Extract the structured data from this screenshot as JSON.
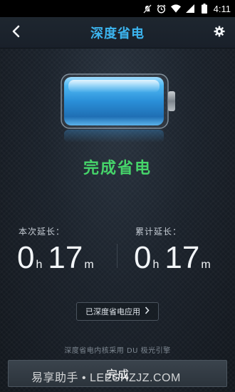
{
  "status_bar": {
    "time": "4:11",
    "icons": [
      "mute-icon",
      "alarm-icon",
      "wifi-icon",
      "signal-icon",
      "battery-icon"
    ]
  },
  "header": {
    "title": "深度省电",
    "back_icon": "chevron-left-icon",
    "settings_icon": "gear-icon"
  },
  "battery": {
    "level": 1.0,
    "color": "#3aa6e6"
  },
  "result": {
    "title": "完成省电",
    "color": "#46d46a"
  },
  "stats": {
    "this_time": {
      "label": "本次延长：",
      "hours": "0",
      "hours_unit": "h",
      "minutes": "17",
      "minutes_unit": "m"
    },
    "total": {
      "label": "累计延长：",
      "hours": "0",
      "hours_unit": "h",
      "minutes": "17",
      "minutes_unit": "m"
    }
  },
  "apps_button": {
    "label": "已深度省电应用",
    "icon": "chevron-right-icon"
  },
  "kernel_note": "深度省电内核采用 DU 极光引擎",
  "finish_button": {
    "label": "完成"
  },
  "watermark": "易享助手 • LEESHZJZ.COM"
}
